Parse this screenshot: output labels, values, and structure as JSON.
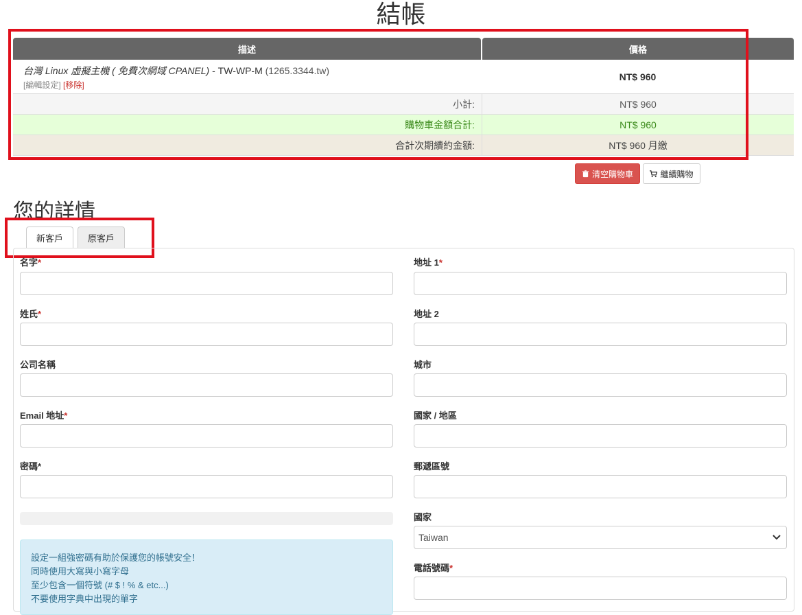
{
  "page": {
    "title": "結帳"
  },
  "cart": {
    "headers": {
      "description": "描述",
      "price": "價格"
    },
    "item": {
      "product_group": "台灣 Linux 虛擬主機 ( 免費次網域 CPANEL)",
      "product_name": " - TW-WP-M",
      "domain": " (1265.3344.tw)",
      "edit_label": "[編輯設定]",
      "remove_label": "[移除]",
      "price": "NT$ 960"
    },
    "subtotal": {
      "label": "小計:",
      "value": "NT$ 960"
    },
    "cart_total": {
      "label": "購物車金額合計:",
      "value": "NT$ 960"
    },
    "recurring": {
      "label": "合計次期續約金額:",
      "value": "NT$ 960 月繳"
    }
  },
  "buttons": {
    "empty_cart": "清空購物車",
    "continue_shopping": "繼續購物"
  },
  "details": {
    "title": "您的詳情",
    "tabs": [
      "新客戶",
      "原客戶"
    ]
  },
  "form": {
    "first_name": "名字",
    "last_name": "姓氏",
    "company": "公司名稱",
    "email": "Email 地址",
    "password": "密碼*",
    "address1": "地址 1",
    "address2": "地址 2",
    "city": "城市",
    "state": "國家 / 地區",
    "postcode": "郵遞區號",
    "country": "國家",
    "country_value": "Taiwan",
    "phone": "電話號碼",
    "required_mark": "*"
  },
  "password_hint": {
    "title": "設定一組強密碼有助於保護您的帳號安全！",
    "lines": [
      "同時使用大寫與小寫字母",
      "至少包含一個符號 (# $ ! % & etc...)",
      "不要使用字典中出現的單字"
    ]
  },
  "colors": {
    "highlight_box": "#e0101c",
    "danger": "#d9534f",
    "header": "#666666"
  }
}
